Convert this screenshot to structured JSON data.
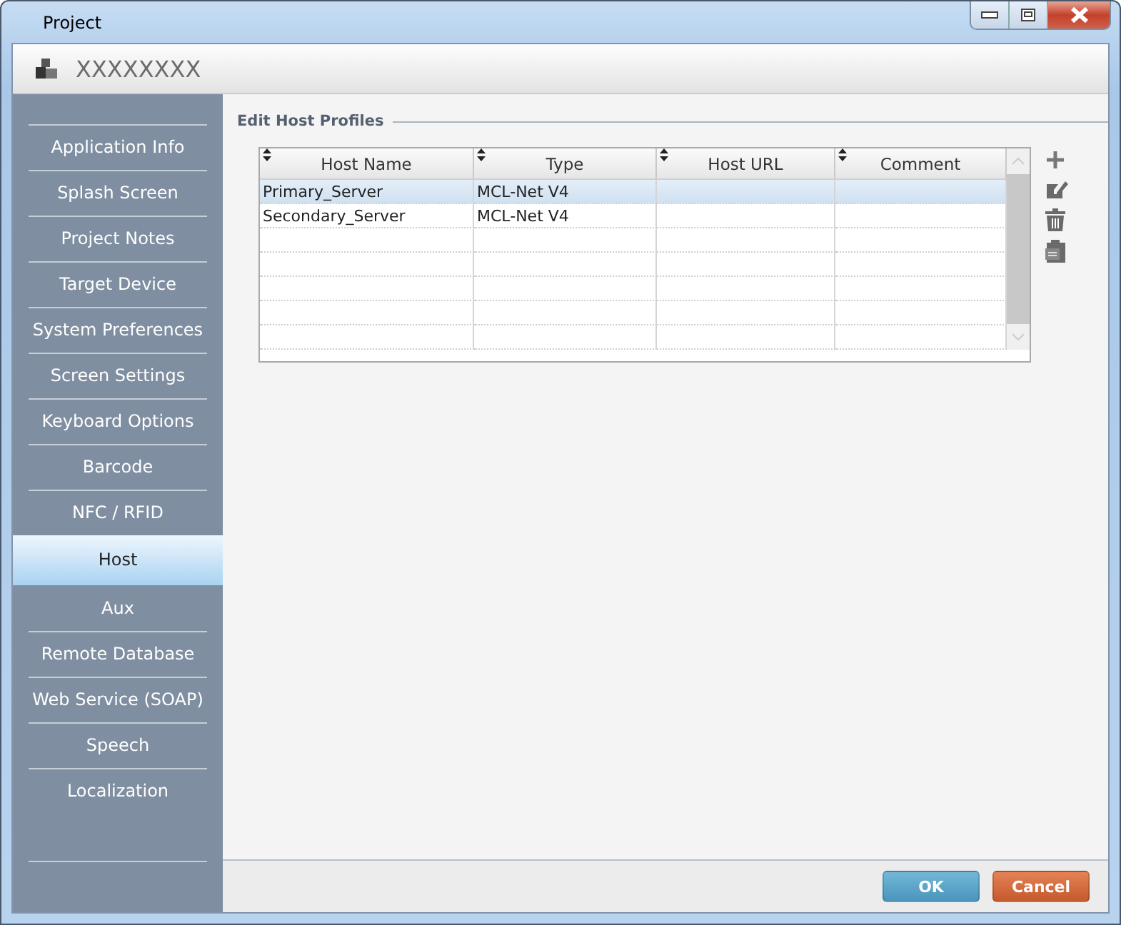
{
  "window": {
    "title": "Project"
  },
  "header": {
    "title": "XXXXXXXX"
  },
  "sidebar": {
    "items": [
      {
        "label": "Application Info",
        "selected": false
      },
      {
        "label": "Splash Screen",
        "selected": false
      },
      {
        "label": "Project Notes",
        "selected": false
      },
      {
        "label": "Target Device",
        "selected": false
      },
      {
        "label": "System Preferences",
        "selected": false
      },
      {
        "label": "Screen Settings",
        "selected": false
      },
      {
        "label": "Keyboard Options",
        "selected": false
      },
      {
        "label": "Barcode",
        "selected": false
      },
      {
        "label": "NFC / RFID",
        "selected": false
      },
      {
        "label": "Host",
        "selected": true
      },
      {
        "label": "Aux",
        "selected": false
      },
      {
        "label": "Remote Database",
        "selected": false
      },
      {
        "label": "Web Service (SOAP)",
        "selected": false
      },
      {
        "label": "Speech",
        "selected": false
      },
      {
        "label": "Localization",
        "selected": false
      }
    ]
  },
  "section": {
    "title": "Edit Host Profiles"
  },
  "table": {
    "columns": [
      "Host Name",
      "Type",
      "Host URL",
      "Comment"
    ],
    "rows": [
      {
        "cells": [
          "Primary_Server",
          "MCL-Net V4"
        ],
        "selected": true
      },
      {
        "cells": [
          "Secondary_Server",
          "MCL-Net V4"
        ],
        "selected": false
      }
    ]
  },
  "buttons": [
    {
      "label": "OK",
      "kind": "primary"
    },
    {
      "label": "Cancel",
      "kind": "danger"
    }
  ]
}
